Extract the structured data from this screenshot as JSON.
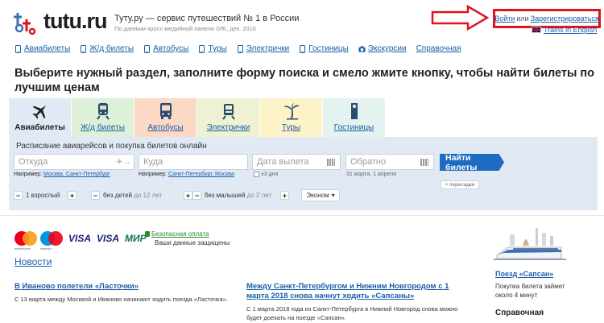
{
  "header": {
    "logo_text": "tutu.ru",
    "tagline": "Туту.ру — сервис путешествий № 1 в России",
    "subtag": "По данным кросс-медийной панели GfK, дек. 2016",
    "login": "Войти",
    "or": "или",
    "register": "Зарегистрироваться",
    "english": "Trains in English"
  },
  "nav": {
    "items": [
      "Авиабилеты",
      "Ж/д билеты",
      "Автобусы",
      "Туры",
      "Электрички",
      "Гостиницы",
      "Экскурсии",
      "Справочная"
    ]
  },
  "headline": "Выберите нужный раздел, заполните форму поиска и смело жмите кнопку, чтобы найти билеты по лучшим ценам",
  "tabs": [
    {
      "label": "Авиабилеты",
      "icon": "airplane-icon",
      "color": "#e1eaf4"
    },
    {
      "label": "Ж/д билеты",
      "icon": "train-icon",
      "color": "#dff0d8"
    },
    {
      "label": "Автобусы",
      "icon": "bus-icon",
      "color": "#fbd9c4"
    },
    {
      "label": "Электрички",
      "icon": "suburban-train-icon",
      "color": "#eef1d2"
    },
    {
      "label": "Туры",
      "icon": "palm-icon",
      "color": "#fdf3c8"
    },
    {
      "label": "Гостиницы",
      "icon": "door-hanger-icon",
      "color": "#e4f3ef"
    }
  ],
  "search": {
    "title": "Расписание авиарейсов и покупка билетов онлайн",
    "from_placeholder": "Откуда",
    "to_placeholder": "Куда",
    "date_placeholder": "Дата вылета",
    "return_placeholder": "Обратно",
    "find_button": "Найти билеты",
    "example_label": "Например:",
    "hint_from": "Москва, Санкт-Петербург",
    "hint_to": "Санкт-Петербург, Москва",
    "hint_pm": "±3 дня",
    "hint_dates": "31 марта, 1 апреля",
    "transfer": "+ пересадки",
    "adults": "1 взрослый",
    "children": "без детей",
    "children_age": "до 12 лет",
    "infants": "без малышей",
    "infants_age": "до 2 лет",
    "class": "Эконом"
  },
  "payments": {
    "mastercard_caption": "mastercard",
    "maestro_caption": "maestro",
    "visa1": "VISA",
    "visa2": "VISA",
    "mir": "МИР",
    "secure_title": "Безопасная оплата",
    "secure_sub": "Ваши данные защищены"
  },
  "news": {
    "heading": "Новости",
    "items": [
      {
        "title": "В Иваново полетели «Ласточки»",
        "body": "С 13 марта между Москвой и Иваново начинают ходить поезда «Ласточка»."
      },
      {
        "title": "Между Санкт-Петербургом и Нижним Новгородом с 1 марта 2018 снова начнут ходить «Сапсаны»",
        "body": "С 1 марта 2018 года из Санкт-Петербурга в Нижний Новгород снова можно будет доехать на поезде «Сапсан»."
      }
    ]
  },
  "sidebar": {
    "sapsan_title": "Поезд «Сапсан»",
    "sapsan_body": "Покупка билета займет около 4 минут",
    "reference": "Справочная"
  },
  "colors": {
    "link": "#1b5ea8",
    "accent": "#1f6bc4",
    "annotation": "#e0141b",
    "panel": "#e1eaf4"
  }
}
